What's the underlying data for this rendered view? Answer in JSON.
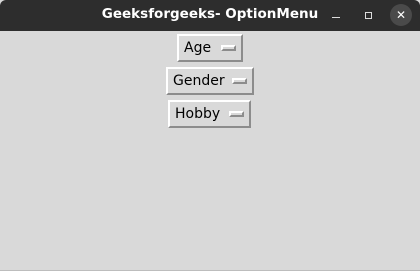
{
  "window": {
    "title": "Geeksforgeeks- OptionMenu",
    "controls": {
      "minimize_icon": "minimize-icon",
      "maximize_icon": "maximize-icon",
      "close_icon": "close-icon",
      "close_glyph": "✕"
    }
  },
  "option_menus": [
    {
      "selected": "Age"
    },
    {
      "selected": "Gender"
    },
    {
      "selected": "Hobby"
    }
  ],
  "colors": {
    "titlebar": "#2d2d2d",
    "background": "#d9d9d9",
    "close_button": "#4a4a4a"
  }
}
